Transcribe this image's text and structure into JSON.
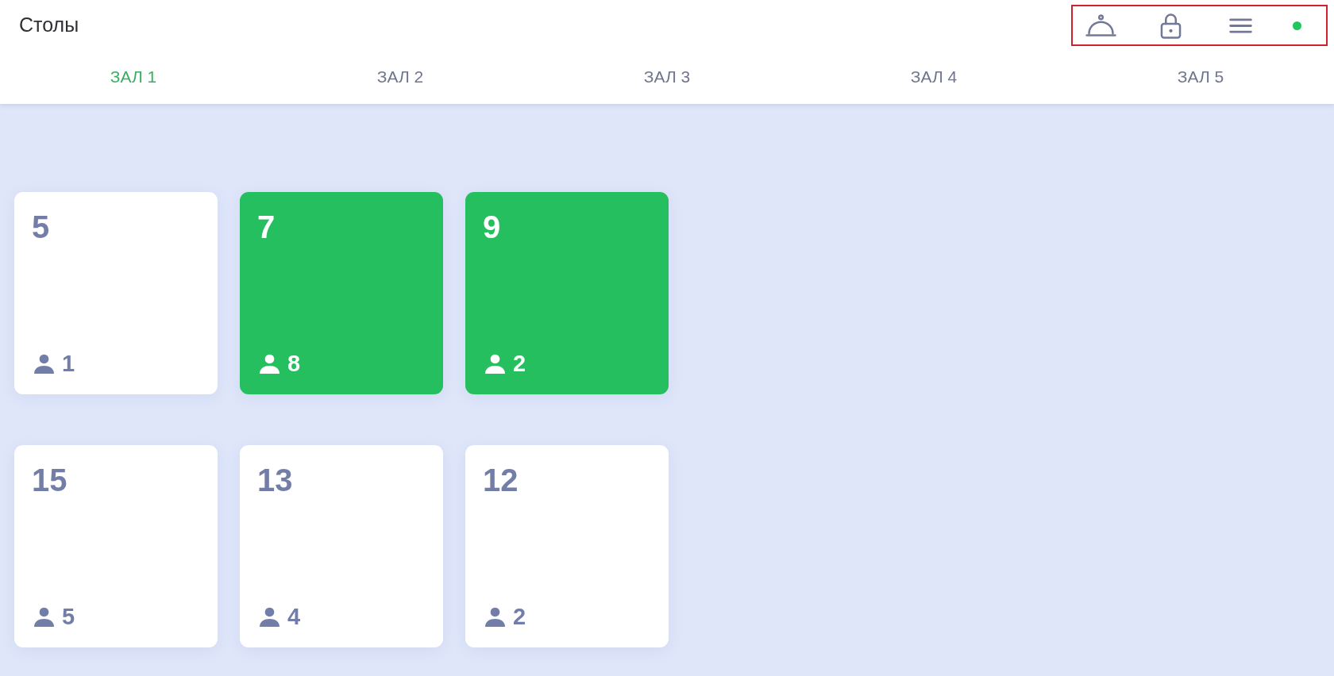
{
  "header": {
    "title": "Столы",
    "status_indicator": {
      "online": true
    }
  },
  "tabs": [
    {
      "label": "ЗАЛ 1",
      "selected": true
    },
    {
      "label": "ЗАЛ 2",
      "selected": false
    },
    {
      "label": "ЗАЛ 3",
      "selected": false
    },
    {
      "label": "ЗАЛ 4",
      "selected": false
    },
    {
      "label": "ЗАЛ 5",
      "selected": false
    }
  ],
  "tables": [
    {
      "number": "5",
      "guests": "1",
      "occupied": false
    },
    {
      "number": "7",
      "guests": "8",
      "occupied": true
    },
    {
      "number": "9",
      "guests": "2",
      "occupied": true
    },
    {
      "number": "15",
      "guests": "5",
      "occupied": false
    },
    {
      "number": "13",
      "guests": "4",
      "occupied": false
    },
    {
      "number": "12",
      "guests": "2",
      "occupied": false
    }
  ]
}
